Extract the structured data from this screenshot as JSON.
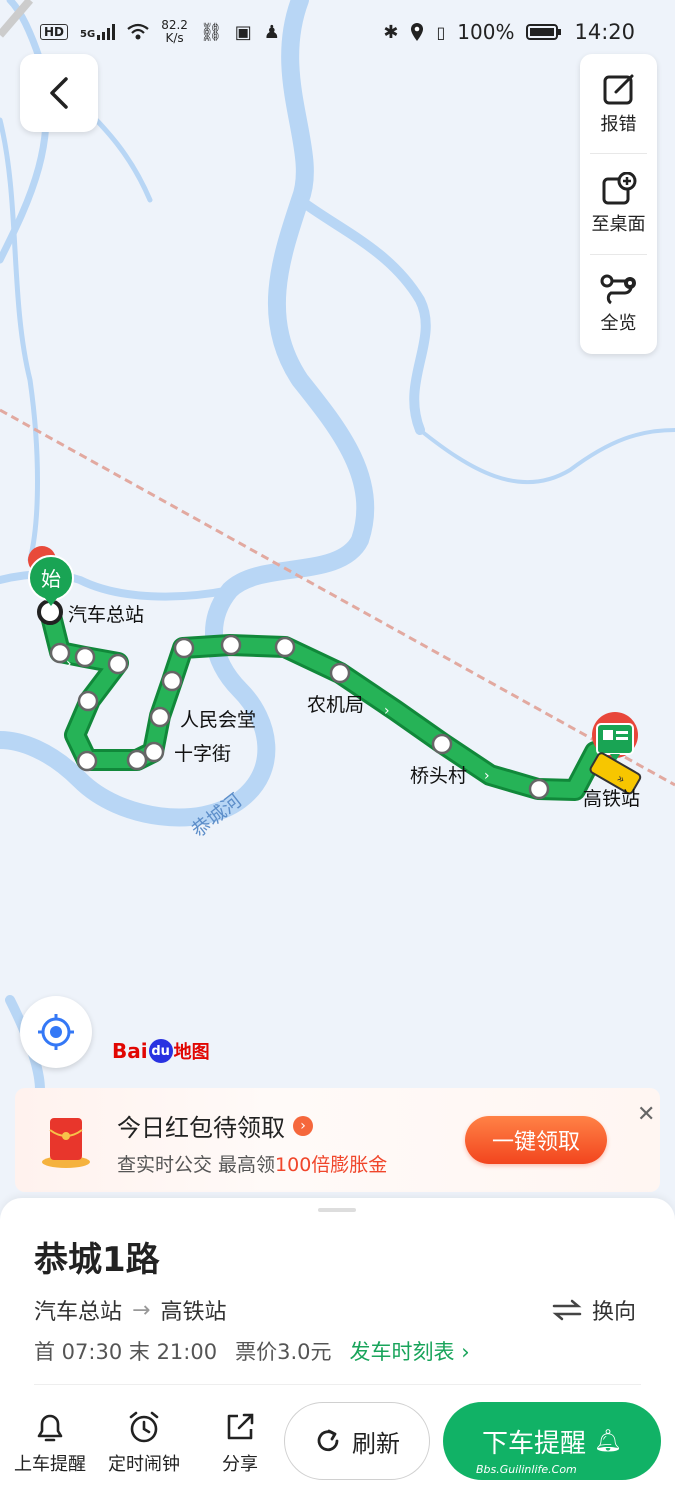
{
  "status_bar": {
    "left_badges": [
      "HD",
      "5G"
    ],
    "net_speed_value": "82.2",
    "net_speed_unit": "K/s",
    "battery": "100%",
    "time": "14:20"
  },
  "tools": {
    "report_label": "报错",
    "desktop_label": "至桌面",
    "overview_label": "全览"
  },
  "map": {
    "start_marker": "始",
    "stops": [
      "汽车总站",
      "人民会堂",
      "十字街",
      "农机局",
      "桥头村",
      "高铁站"
    ],
    "river_label": "恭城河",
    "logo": {
      "bai": "Bai",
      "du": "du",
      "ditu": "地图"
    },
    "route_color": "#1aa34a",
    "river_color": "#b8d6f5"
  },
  "promo": {
    "title": "今日红包待领取",
    "subtitle_prefix": "查实时公交 最高领",
    "subtitle_highlight": "100倍膨胀金",
    "button": "一键领取",
    "close": "✕"
  },
  "route": {
    "name": "恭城1路",
    "from": "汽车总站",
    "to": "高铁站",
    "switch_label": "换向",
    "first_bus": "首 07:30",
    "last_bus": "末 21:00",
    "fare": "票价3.0元",
    "timetable_link": "发车时刻表",
    "timetable_arrow": "›"
  },
  "actions": {
    "board_alert": "上车提醒",
    "alarm": "定时闹钟",
    "share": "分享",
    "refresh": "刷新",
    "alight_alert": "下车提醒"
  },
  "watermark": "Bbs.Guilinlife.Com"
}
